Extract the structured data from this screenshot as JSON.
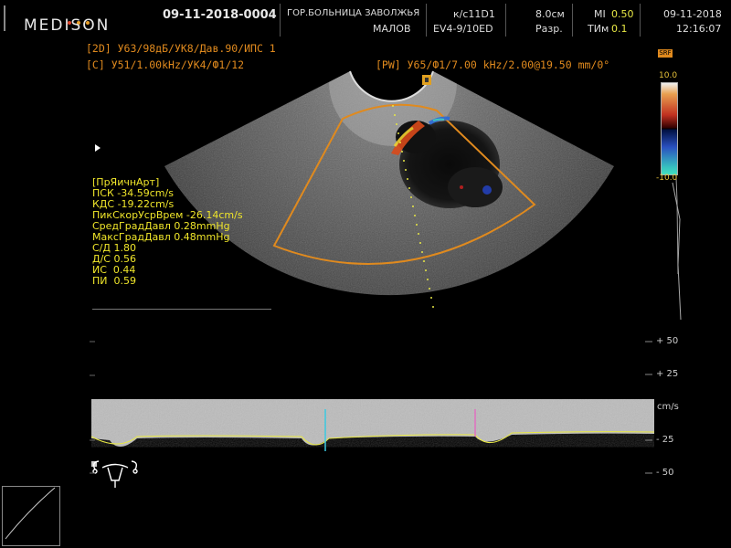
{
  "header": {
    "brand": "MEDISON",
    "logo_dot_colors": [
      "#e0462d",
      "#e8a02a",
      "#e8a02a"
    ],
    "study_id": "09-11-2018-0004",
    "hospital": "ГОР.БОЛЬНИЦА ЗАВОЛЖЬЯ",
    "operator": "МАЛОВ",
    "preset": "к/с11D1",
    "probe": "EV4-9/10ED",
    "depth": "8.0см",
    "resolution": "Разр.",
    "mi_label": "MI",
    "mi_value": "0.50",
    "tim_label": "ТИм",
    "tim_value": "0.1",
    "date": "09-11-2018",
    "time": "12:16:07"
  },
  "params": {
    "mode_2d_tag": "[2D]",
    "mode_2d_text": " У63/98дБ/УК8/Дав.90/ИПС 1",
    "mode_c_tag": "[C]",
    "mode_c_text": " У51/1.00kHz/УК4/Ф1/12",
    "mode_pw_tag": "[PW]",
    "mode_pw_text": " У65/Ф1/7.00 kHz/2.00@19.50 mm/0°"
  },
  "measurements": {
    "title": "[ПрЯичнАрт]",
    "items": [
      "ПСК -34.59cm/s",
      "КДС -19.22cm/s",
      "ПикСкорУсрВрем -26.14cm/s",
      "СредГрадДавл 0.28mmHg",
      "МаксГрадДавл 0.48mmHg",
      "С/Д 1.80",
      "Д/С 0.56",
      "ИС  0.44",
      "ПИ  0.59"
    ]
  },
  "doppler_scale": {
    "p50": "+ 50",
    "p25": "+ 25",
    "unit": "cm/s",
    "m25": "- 25",
    "m50": "- 50"
  },
  "colorbar": {
    "top_value": "10.0",
    "bottom_value": "-10.0",
    "badge": "SRF"
  },
  "colors": {
    "accent_orange": "#e08a1e",
    "measurement_yellow": "#f0e62a"
  }
}
